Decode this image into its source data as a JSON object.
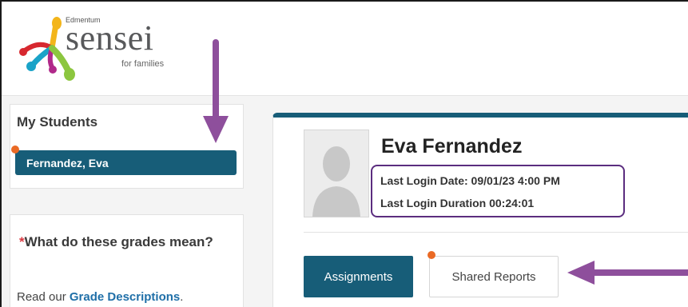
{
  "header": {
    "brand": {
      "top": "Edmentum",
      "main": "sensei",
      "sub": "for families"
    }
  },
  "sidebar": {
    "title": "My Students",
    "students": [
      {
        "label": "Fernandez, Eva"
      }
    ]
  },
  "grades_info": {
    "star": "*",
    "question": "What do these grades mean?",
    "read_prefix": "Read our ",
    "link": "Grade Descriptions",
    "read_suffix": "."
  },
  "student": {
    "name": "Eva Fernandez",
    "last_login_date": "Last Login Date: 09/01/23 4:00 PM",
    "last_login_duration": "Last Login Duration 00:24:01"
  },
  "tabs": [
    {
      "label": "Assignments"
    },
    {
      "label": "Shared Reports"
    }
  ],
  "colors": {
    "primary": "#175d78",
    "notification": "#ea6a25",
    "annotation": "#8e4f9c",
    "highlight_box": "#5b2d7f"
  },
  "icons": [
    "sensei-logo-icon",
    "avatar-placeholder-icon",
    "notification-dot-icon"
  ]
}
